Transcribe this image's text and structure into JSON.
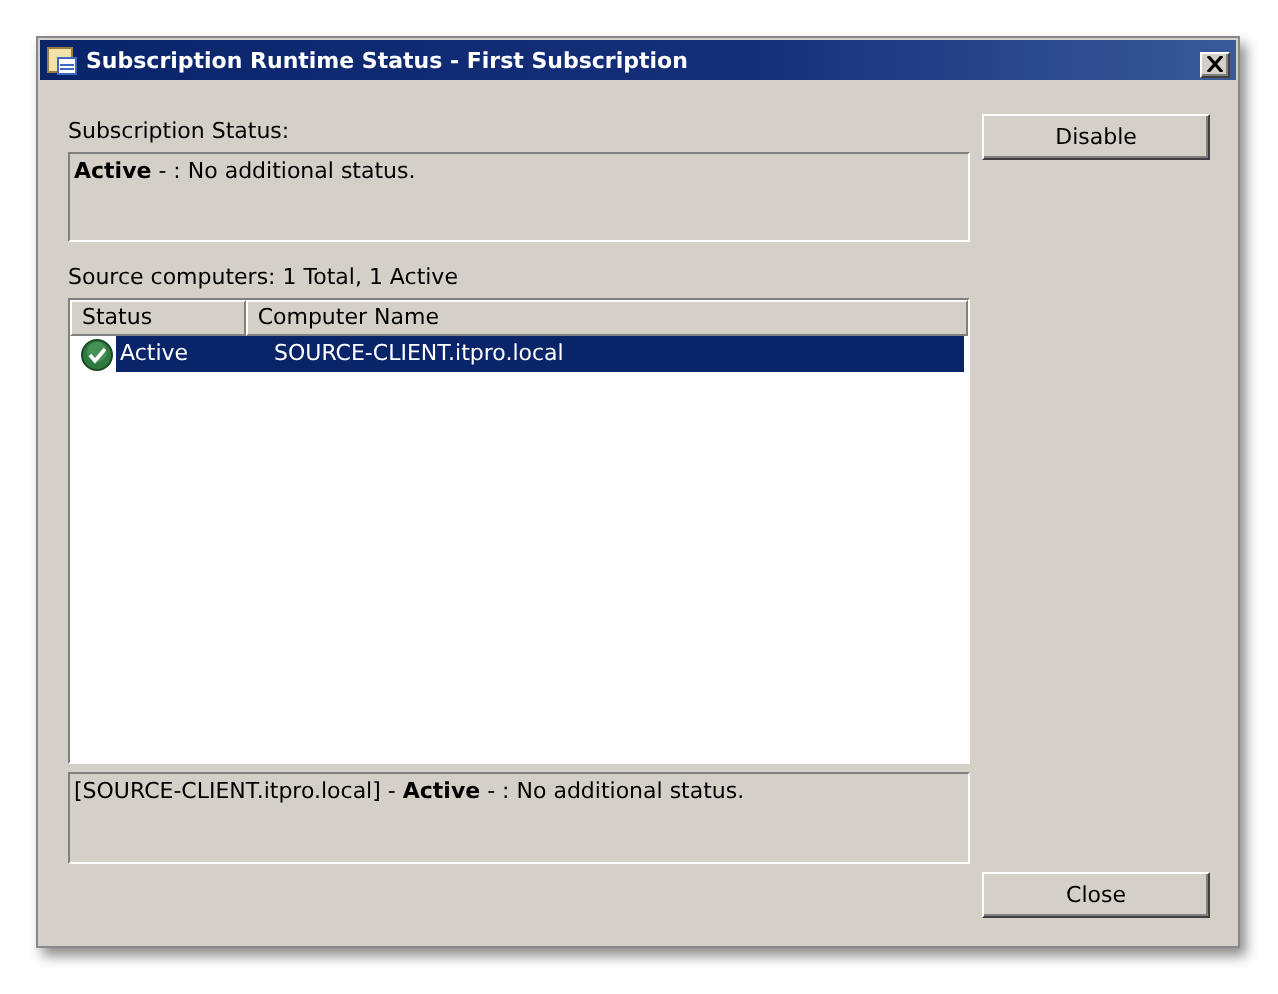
{
  "window": {
    "title": "Subscription Runtime Status - First Subscription"
  },
  "subscription_status": {
    "label": "Subscription Status:",
    "text": "**Active** - : No additional status."
  },
  "source_computers": {
    "label": "Source computers: 1 Total, 1 Active",
    "columns": [
      "Status",
      "Computer Name"
    ],
    "rows": [
      {
        "status": "Active",
        "computer_name": "SOURCE-CLIENT.itpro.local",
        "selected": true
      }
    ]
  },
  "detail": "[SOURCE-CLIENT.itpro.local] - **Active** - : No additional status.",
  "buttons": [
    {
      "label": "Disable"
    },
    {
      "label": "Close"
    }
  ]
}
